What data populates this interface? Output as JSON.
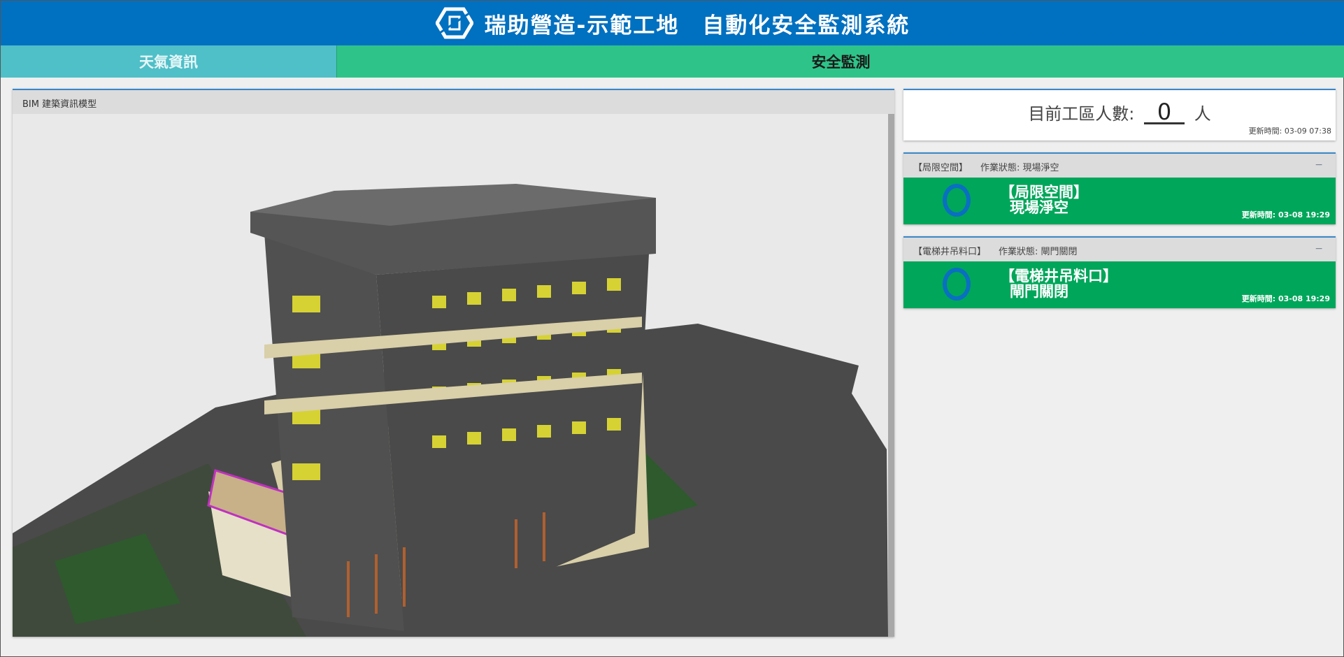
{
  "header": {
    "title": "瑞助營造-示範工地　自動化安全監測系統",
    "logo_icon": "company-logo"
  },
  "tabs": [
    {
      "label": "天氣資訊"
    },
    {
      "label": "安全監測"
    }
  ],
  "bim": {
    "title": "BIM 建築資訊模型"
  },
  "worker_count": {
    "label": "目前工區人數:",
    "value": "0",
    "unit": "人",
    "updated": "更新時間: 03-09 07:38"
  },
  "cards": [
    {
      "name": "【局限空間】",
      "status": "作業狀態: 現場淨空",
      "title": "【局限空間】",
      "sub": "現場淨空",
      "updated": "更新時間: 03-08 19:29",
      "collapse": "−",
      "color": "#00a65a"
    },
    {
      "name": "【電梯井吊料口】",
      "status": "作業狀態: 閘門關閉",
      "title": "【電梯井吊料口】",
      "sub": "閘門關閉",
      "updated": "更新時間: 03-08 19:29",
      "collapse": "−",
      "color": "#00a65a"
    }
  ]
}
